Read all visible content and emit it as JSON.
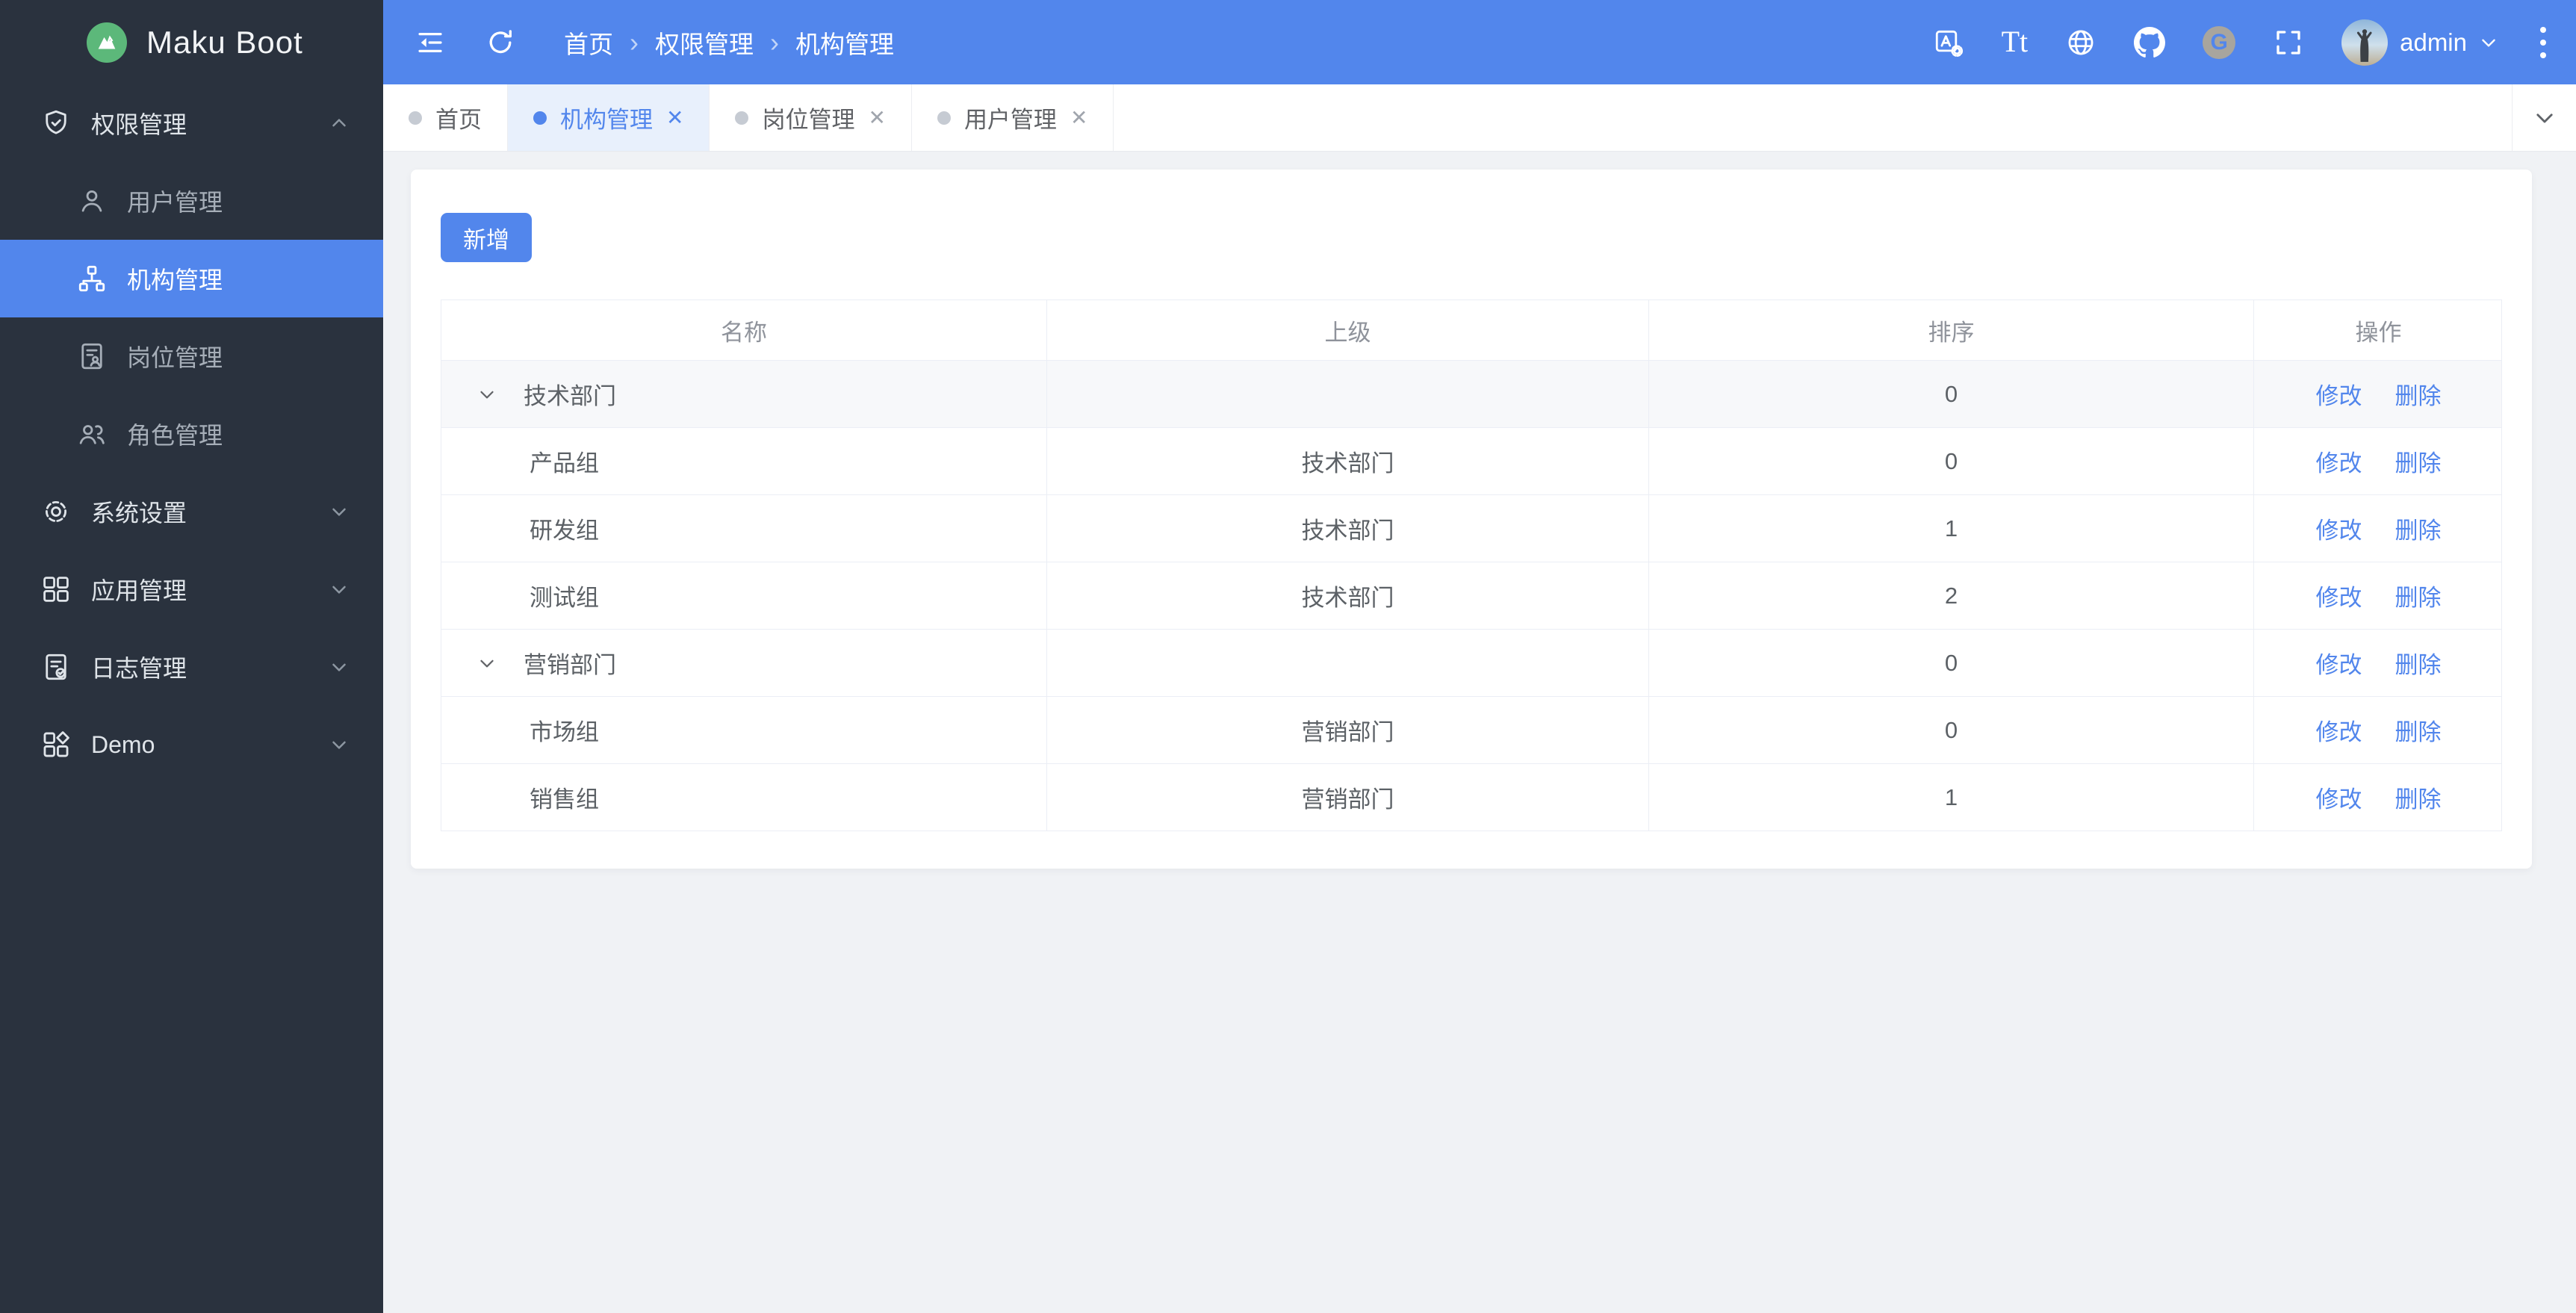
{
  "app": {
    "name": "Maku Boot"
  },
  "header": {
    "breadcrumb": [
      "首页",
      "权限管理",
      "机构管理"
    ],
    "user": {
      "name": "admin"
    },
    "icon_names": [
      "collapse-sidebar",
      "refresh",
      "language-settings",
      "font-size",
      "globe",
      "github",
      "gitee",
      "fullscreen",
      "more-menu"
    ]
  },
  "glyphs": {
    "breadcrumb_sep": "›",
    "tab_close": "✕",
    "font_size_icon": "Tt",
    "gitee_letter": "G"
  },
  "sidebar": {
    "items": [
      {
        "label": "权限管理",
        "icon": "shield-check",
        "type": "group",
        "expanded": true
      },
      {
        "label": "用户管理",
        "icon": "user"
      },
      {
        "label": "机构管理",
        "icon": "org-tree",
        "active": true
      },
      {
        "label": "岗位管理",
        "icon": "post-document"
      },
      {
        "label": "角色管理",
        "icon": "roles-people"
      },
      {
        "label": "系统设置",
        "icon": "gear",
        "type": "group"
      },
      {
        "label": "应用管理",
        "icon": "apps-grid",
        "type": "group"
      },
      {
        "label": "日志管理",
        "icon": "log-document",
        "type": "group"
      },
      {
        "label": "Demo",
        "icon": "demo-grid",
        "type": "group"
      }
    ]
  },
  "tabs": {
    "items": [
      {
        "label": "首页",
        "active": false,
        "closable": false
      },
      {
        "label": "机构管理",
        "active": true,
        "closable": true
      },
      {
        "label": "岗位管理",
        "active": false,
        "closable": true
      },
      {
        "label": "用户管理",
        "active": false,
        "closable": true
      }
    ]
  },
  "toolbar": {
    "add_label": "新增"
  },
  "table": {
    "headers": [
      "名称",
      "上级",
      "排序",
      "操作"
    ],
    "action_labels": {
      "edit": "修改",
      "delete": "删除"
    },
    "rows": [
      {
        "name": "技术部门",
        "parent": "",
        "sort": "0",
        "expandable": true,
        "child": false,
        "highlight": true
      },
      {
        "name": "产品组",
        "parent": "技术部门",
        "sort": "0",
        "child": true
      },
      {
        "name": "研发组",
        "parent": "技术部门",
        "sort": "1",
        "child": true
      },
      {
        "name": "测试组",
        "parent": "技术部门",
        "sort": "2",
        "child": true
      },
      {
        "name": "营销部门",
        "parent": "",
        "sort": "0",
        "expandable": true,
        "child": false
      },
      {
        "name": "市场组",
        "parent": "营销部门",
        "sort": "0",
        "child": true
      },
      {
        "name": "销售组",
        "parent": "营销部门",
        "sort": "1",
        "child": true
      }
    ]
  },
  "colors": {
    "primary": "#5286ec",
    "sidebar_bg": "#2a323e",
    "page_bg": "#f0f2f5",
    "logo_green": "#5cb87a",
    "table_border": "#ebeef5",
    "active_tab_bg": "#e8f0fc"
  }
}
